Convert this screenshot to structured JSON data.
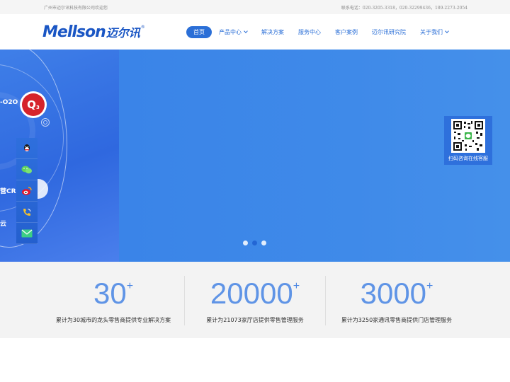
{
  "topbar": {
    "welcome": "广州市迈尔讯科技有限公司欢迎您",
    "phones": "联系电话：020-3205-3318，020-32299436，189-2273-2054"
  },
  "logo": {
    "en": "Mellson",
    "cn": "迈尔讯",
    "reg": "®"
  },
  "nav": {
    "items": [
      {
        "label": "首页"
      },
      {
        "label": "产品中心"
      },
      {
        "label": "解决方案"
      },
      {
        "label": "服务中心"
      },
      {
        "label": "客户案例"
      },
      {
        "label": "迈尔讯研究院"
      },
      {
        "label": "关于我们"
      }
    ]
  },
  "banner": {
    "text_o2o": "-O2O",
    "text_badge": "Q",
    "text_badge_sub": "3",
    "text_cr": "营CR",
    "text_yun": "云",
    "qr_caption": "扫码咨询在线客服"
  },
  "colors": {
    "brand": "#2b6fd7",
    "banner": "#3e86e6",
    "stat_number": "#5f94e6",
    "badge_red": "#d6232b"
  },
  "side_tools": [
    "qq-icon",
    "wechat-icon",
    "weibo-icon",
    "phone-icon",
    "email-icon"
  ],
  "carousel": {
    "slides": 3,
    "active_index": 1
  },
  "stats": [
    {
      "number": "30",
      "plus": "+",
      "desc": "累计为30城市的龙头零售商提供专业解决方案"
    },
    {
      "number": "20000",
      "plus": "+",
      "desc": "累计为21073家厅店提供零售管理服务"
    },
    {
      "number": "3000",
      "plus": "+",
      "desc": "累计为3250家通讯零售商提供门店管理服务"
    }
  ]
}
